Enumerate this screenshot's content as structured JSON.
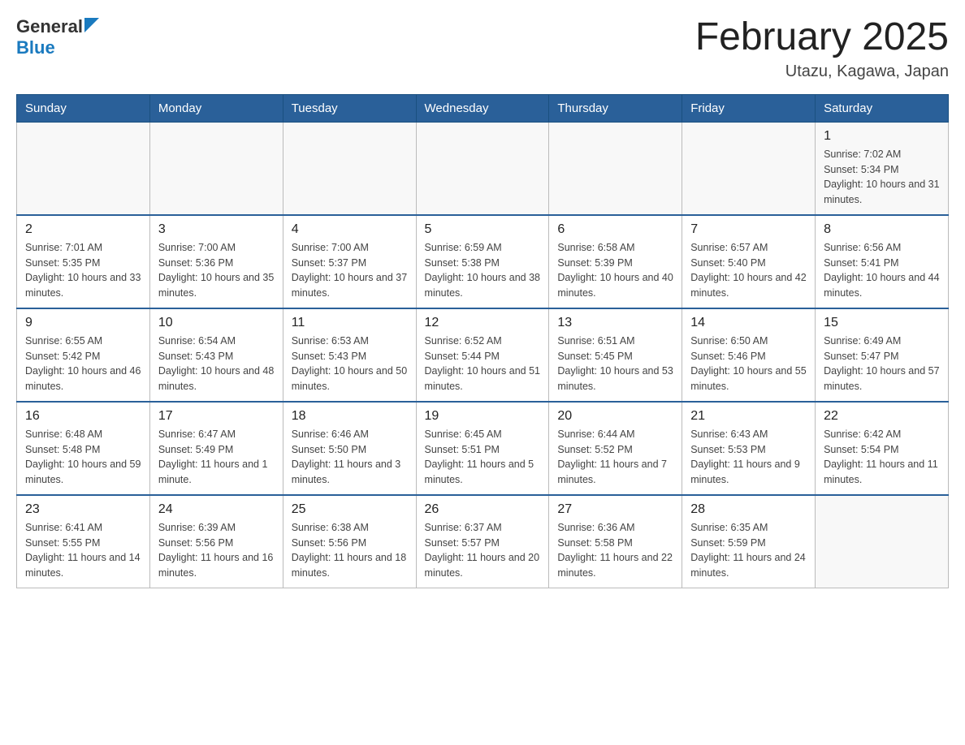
{
  "header": {
    "logo_general": "General",
    "logo_blue": "Blue",
    "month_title": "February 2025",
    "location": "Utazu, Kagawa, Japan"
  },
  "days_of_week": [
    "Sunday",
    "Monday",
    "Tuesday",
    "Wednesday",
    "Thursday",
    "Friday",
    "Saturday"
  ],
  "weeks": [
    {
      "days": [
        {
          "num": "",
          "info": ""
        },
        {
          "num": "",
          "info": ""
        },
        {
          "num": "",
          "info": ""
        },
        {
          "num": "",
          "info": ""
        },
        {
          "num": "",
          "info": ""
        },
        {
          "num": "",
          "info": ""
        },
        {
          "num": "1",
          "info": "Sunrise: 7:02 AM\nSunset: 5:34 PM\nDaylight: 10 hours and 31 minutes."
        }
      ]
    },
    {
      "days": [
        {
          "num": "2",
          "info": "Sunrise: 7:01 AM\nSunset: 5:35 PM\nDaylight: 10 hours and 33 minutes."
        },
        {
          "num": "3",
          "info": "Sunrise: 7:00 AM\nSunset: 5:36 PM\nDaylight: 10 hours and 35 minutes."
        },
        {
          "num": "4",
          "info": "Sunrise: 7:00 AM\nSunset: 5:37 PM\nDaylight: 10 hours and 37 minutes."
        },
        {
          "num": "5",
          "info": "Sunrise: 6:59 AM\nSunset: 5:38 PM\nDaylight: 10 hours and 38 minutes."
        },
        {
          "num": "6",
          "info": "Sunrise: 6:58 AM\nSunset: 5:39 PM\nDaylight: 10 hours and 40 minutes."
        },
        {
          "num": "7",
          "info": "Sunrise: 6:57 AM\nSunset: 5:40 PM\nDaylight: 10 hours and 42 minutes."
        },
        {
          "num": "8",
          "info": "Sunrise: 6:56 AM\nSunset: 5:41 PM\nDaylight: 10 hours and 44 minutes."
        }
      ]
    },
    {
      "days": [
        {
          "num": "9",
          "info": "Sunrise: 6:55 AM\nSunset: 5:42 PM\nDaylight: 10 hours and 46 minutes."
        },
        {
          "num": "10",
          "info": "Sunrise: 6:54 AM\nSunset: 5:43 PM\nDaylight: 10 hours and 48 minutes."
        },
        {
          "num": "11",
          "info": "Sunrise: 6:53 AM\nSunset: 5:43 PM\nDaylight: 10 hours and 50 minutes."
        },
        {
          "num": "12",
          "info": "Sunrise: 6:52 AM\nSunset: 5:44 PM\nDaylight: 10 hours and 51 minutes."
        },
        {
          "num": "13",
          "info": "Sunrise: 6:51 AM\nSunset: 5:45 PM\nDaylight: 10 hours and 53 minutes."
        },
        {
          "num": "14",
          "info": "Sunrise: 6:50 AM\nSunset: 5:46 PM\nDaylight: 10 hours and 55 minutes."
        },
        {
          "num": "15",
          "info": "Sunrise: 6:49 AM\nSunset: 5:47 PM\nDaylight: 10 hours and 57 minutes."
        }
      ]
    },
    {
      "days": [
        {
          "num": "16",
          "info": "Sunrise: 6:48 AM\nSunset: 5:48 PM\nDaylight: 10 hours and 59 minutes."
        },
        {
          "num": "17",
          "info": "Sunrise: 6:47 AM\nSunset: 5:49 PM\nDaylight: 11 hours and 1 minute."
        },
        {
          "num": "18",
          "info": "Sunrise: 6:46 AM\nSunset: 5:50 PM\nDaylight: 11 hours and 3 minutes."
        },
        {
          "num": "19",
          "info": "Sunrise: 6:45 AM\nSunset: 5:51 PM\nDaylight: 11 hours and 5 minutes."
        },
        {
          "num": "20",
          "info": "Sunrise: 6:44 AM\nSunset: 5:52 PM\nDaylight: 11 hours and 7 minutes."
        },
        {
          "num": "21",
          "info": "Sunrise: 6:43 AM\nSunset: 5:53 PM\nDaylight: 11 hours and 9 minutes."
        },
        {
          "num": "22",
          "info": "Sunrise: 6:42 AM\nSunset: 5:54 PM\nDaylight: 11 hours and 11 minutes."
        }
      ]
    },
    {
      "days": [
        {
          "num": "23",
          "info": "Sunrise: 6:41 AM\nSunset: 5:55 PM\nDaylight: 11 hours and 14 minutes."
        },
        {
          "num": "24",
          "info": "Sunrise: 6:39 AM\nSunset: 5:56 PM\nDaylight: 11 hours and 16 minutes."
        },
        {
          "num": "25",
          "info": "Sunrise: 6:38 AM\nSunset: 5:56 PM\nDaylight: 11 hours and 18 minutes."
        },
        {
          "num": "26",
          "info": "Sunrise: 6:37 AM\nSunset: 5:57 PM\nDaylight: 11 hours and 20 minutes."
        },
        {
          "num": "27",
          "info": "Sunrise: 6:36 AM\nSunset: 5:58 PM\nDaylight: 11 hours and 22 minutes."
        },
        {
          "num": "28",
          "info": "Sunrise: 6:35 AM\nSunset: 5:59 PM\nDaylight: 11 hours and 24 minutes."
        },
        {
          "num": "",
          "info": ""
        }
      ]
    }
  ]
}
